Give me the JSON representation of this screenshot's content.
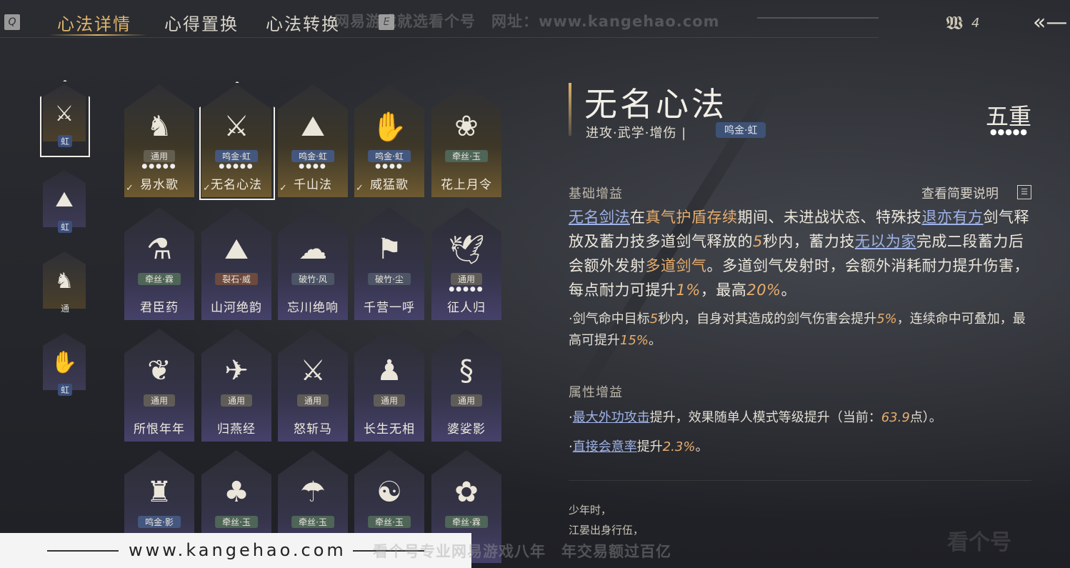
{
  "topbar": {
    "left_key": "Q",
    "right_key": "E",
    "tabs": [
      "心法详情",
      "心得置换",
      "心法转换"
    ],
    "watermark": "网易游戏就选看个号　网址：www.kangehao.com",
    "currency_icon": "feather-icon",
    "currency_value": "4",
    "back_icon": "back-arrow-icon"
  },
  "rail": [
    {
      "glyph": "⚔",
      "tag": "虹"
    },
    {
      "glyph": "⛰",
      "tag": "虹"
    },
    {
      "glyph": "♞",
      "tag": "通"
    },
    {
      "glyph": "✋",
      "tag": "虹"
    }
  ],
  "cards": [
    {
      "name": "易水歌",
      "tag": "通用",
      "dots": "●●●●●",
      "glyph": "♞",
      "check": "✓"
    },
    {
      "name": "无名心法",
      "tag": "鸣金·虹",
      "dots": "●●●●●",
      "glyph": "⚔",
      "check": "✓"
    },
    {
      "name": "千山法",
      "tag": "鸣金·虹",
      "dots": "●●●●",
      "glyph": "⛰",
      "check": "✓"
    },
    {
      "name": "威猛歌",
      "tag": "鸣金·虹",
      "dots": "●●●●",
      "glyph": "✋",
      "check": "✓"
    },
    {
      "name": "花上月令",
      "tag": "牵丝·玉",
      "dots": "",
      "glyph": "❀",
      "check": ""
    },
    {
      "name": "君臣药",
      "tag": "牵丝·霖",
      "dots": "",
      "glyph": "⚗",
      "check": ""
    },
    {
      "name": "山河绝韵",
      "tag": "裂石·威",
      "dots": "",
      "glyph": "⛰",
      "check": ""
    },
    {
      "name": "忘川绝响",
      "tag": "破竹·风",
      "dots": "",
      "glyph": "☁",
      "check": ""
    },
    {
      "name": "千营一呼",
      "tag": "破竹·尘",
      "dots": "",
      "glyph": "⚑",
      "check": ""
    },
    {
      "name": "征人归",
      "tag": "通用",
      "dots": "●●●●●",
      "glyph": "🕊",
      "check": ""
    },
    {
      "name": "所恨年年",
      "tag": "通用",
      "dots": "",
      "glyph": "❦",
      "check": ""
    },
    {
      "name": "归燕经",
      "tag": "通用",
      "dots": "",
      "glyph": "✈",
      "check": ""
    },
    {
      "name": "怒斩马",
      "tag": "通用",
      "dots": "",
      "glyph": "⚔",
      "check": ""
    },
    {
      "name": "长生无相",
      "tag": "通用",
      "dots": "",
      "glyph": "♟",
      "check": ""
    },
    {
      "name": "婆娑影",
      "tag": "通用",
      "dots": "",
      "glyph": "§",
      "check": ""
    },
    {
      "name": "",
      "tag": "鸣金·影",
      "dots": "",
      "glyph": "♜",
      "check": ""
    },
    {
      "name": "",
      "tag": "牵丝·玉",
      "dots": "",
      "glyph": "♣",
      "check": ""
    },
    {
      "name": "",
      "tag": "牵丝·玉",
      "dots": "",
      "glyph": "☂",
      "check": ""
    },
    {
      "name": "",
      "tag": "牵丝·玉",
      "dots": "",
      "glyph": "☯",
      "check": ""
    },
    {
      "name": "",
      "tag": "牵丝·霖",
      "dots": "",
      "glyph": "✿",
      "check": ""
    }
  ],
  "detail": {
    "title": "无名心法",
    "subtitle": "进攻·武学·增伤 |",
    "tag": "鸣金·虹",
    "rank": "五重",
    "rank_dots": "●●●●●",
    "basic_head": "基础增益",
    "view_brief": "查看简要说明",
    "main_desc": {
      "p1": "无名剑法",
      "p2": "在",
      "p3": "真气护盾存续",
      "p4": "期间、未进战状态、特殊技",
      "p5": "退亦有方",
      "p6": "剑气释放及蓄力技多道剑气释放的",
      "p7": "5",
      "p8": "秒内，蓄力技",
      "p9": "无以为家",
      "p10": "完成二段蓄力后会额外发射",
      "p11": "多道剑气",
      "p12": "。多道剑气发射时，会额外消耗耐力提升伤害，每点耐力可提升",
      "p13": "1%",
      "p14": "，最高",
      "p15": "20%",
      "p16": "。"
    },
    "sub_desc": {
      "s1": "·剑气命中目标",
      "s2": "5",
      "s3": "秒内，自身对其造成的剑气伤害会提升",
      "s4": "5%",
      "s5": "，连续命中可叠加，最高可提升",
      "s6": "15%",
      "s7": "。"
    },
    "attr_head": "属性增益",
    "attr1": {
      "a": "·",
      "b": "最大外功攻击",
      "c": "提升，效果随单人模式等级提升（当前：",
      "d": "63.9",
      "e": "点）。"
    },
    "attr2": {
      "a": "·",
      "b": "直接会意率",
      "c": "提升",
      "d": "2.3%",
      "e": "。"
    },
    "poem1": "少年时，",
    "poem2": "江晏出身行伍，"
  },
  "bottom_watermark": {
    "site": "www.kangehao.com",
    "slogan": "看个号专业网易游戏八年　年交易额过百亿",
    "logo": "看个号"
  },
  "colors": {
    "accent_gold": "#e0b46a",
    "highlight": "#e7ad6d",
    "link": "#9fb3e8"
  }
}
